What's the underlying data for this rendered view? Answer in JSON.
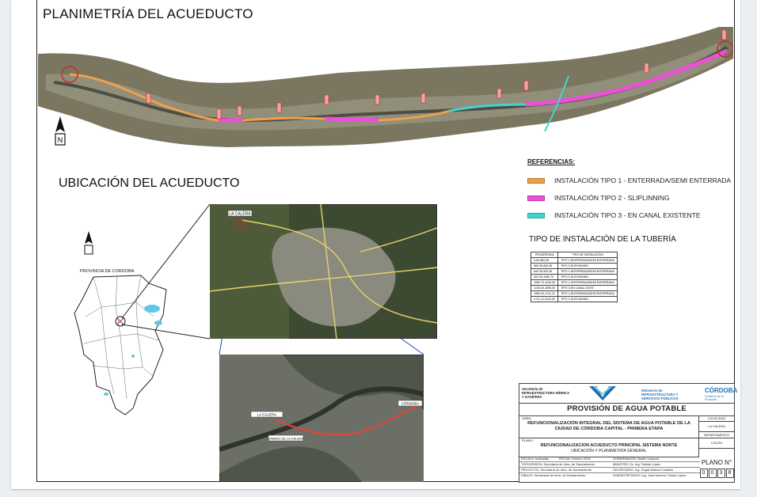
{
  "titles": {
    "planimetria": "PLANIMETRÍA DEL ACUEDUCTO",
    "ubicacion": "UBICACIÓN DEL ACUEDUCTO"
  },
  "referencias": {
    "title": "REFERENCIAS:",
    "items": [
      {
        "label": "INSTALACIÓN TIPO 1 - ENTERRADA/SEMI ENTERRADA",
        "color": "#f0a04b"
      },
      {
        "label": "INSTALACIÓN TIPO 2 - SLIPLINNING",
        "color": "#ef4fd8"
      },
      {
        "label": "INSTALACIÓN TIPO 3 - EN CANAL EXISTENTE",
        "color": "#3fd6d2"
      }
    ]
  },
  "tipo_instalacion": {
    "title": "TIPO DE INSTALACIÓN DE LA TUBERÍA",
    "headers": [
      "PROGRESIVA",
      "TIPO DE INSTALACIÓN"
    ],
    "rows": [
      [
        "0,00-560,35",
        "TIPO 1-ENTERRADA/SEMI ENTERRADA"
      ],
      [
        "560,35-840,35",
        "TIPO 2-SLIPLINNING"
      ],
      [
        "840,35-920,35",
        "TIPO 1-ENTERRADA/SEMI ENTERRADA"
      ],
      [
        "920,35-1060,70",
        "TIPO 2-SLIPLINNING"
      ],
      [
        "1060,70-1230,00",
        "TIPO 1-ENTERRADA/SEMI ENTERRADA"
      ],
      [
        "1230,00-1590,00",
        "TIPO 3-EN CANAL EXIST."
      ],
      [
        "1590,00-1711,12",
        "TIPO 1-ENTERRADA/SEMI ENTERRADA"
      ],
      [
        "1711,12-2240,00",
        "TIPO 2-SLIPLINNING"
      ]
    ]
  },
  "map": {
    "provincia_label": "PROVINCIA DE CÓRDOBA",
    "sat1_label": "LA CALERA",
    "sat2_labels": [
      "LA CALERA",
      "CAMINO DE LA CALERA",
      "CÓRDOBA"
    ]
  },
  "cartouche": {
    "secretaria": "Secretaría de INFRAESTRUCTURA HÍDRICA Y GASÍFERA",
    "ministerio": "Ministerio de INFRAESTRUCTURA Y SERVICIOS PÚBLICOS",
    "gobierno": "CÓRDOBA",
    "gobierno_sub": "Gobierno de la Provincia",
    "main_title": "PROVISIÓN DE AGUA POTABLE",
    "obra_label": "OBRA:",
    "obra": "REFUNCIONALIZACIÓN INTEGRAL DEL SISTEMA DE AGUA POTABLE DE LA CIUDAD DE CÓRDOBA CAPITAL - PRIMERA ETAPA",
    "plano_label": "PLANO:",
    "plano_1": "REFUNCIONALIZACION ACUEDUCTO PRINCIPAL SISTEMA NORTE",
    "plano_2": "UBICACIÓN Y PLANIMETRÍA GENERAL",
    "localidad_label": "LOCALIDAD",
    "localidad": "LA CALERA",
    "departamento_label": "DEPARTAMENTO",
    "departamento": "COLÓN",
    "plano_n_label": "PLANO N°",
    "plano_n": [
      "0",
      "0",
      "3",
      "8"
    ],
    "rows": [
      [
        "ESCALA: Indicadas",
        "FECHA: Febrero 2025",
        "GOBERNADOR: Martín Llaryora"
      ],
      [
        "TOPOGRAFÍA: Secretaría de Infra. de Saneamiento",
        "",
        "MINISTRO: Dr. Ing. Fabián López"
      ],
      [
        "PROYECTO: Secretaría de Infra. de Saneamiento",
        "",
        "SECRETARIO: Ing. Edgar Manuel Castello"
      ],
      [
        "DIBUJO: Secretaría de Infra. de Saneamiento",
        "",
        "SUBSECRETARIO: Ing. José Antonio Chiodo López"
      ]
    ]
  }
}
